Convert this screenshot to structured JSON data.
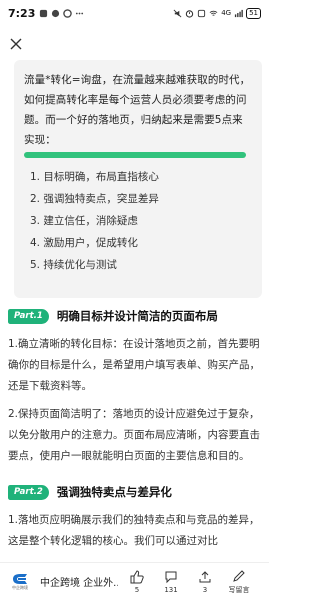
{
  "status_bar": {
    "time": "7:23",
    "network": "4G",
    "battery": "51"
  },
  "icons": {
    "close": "close-icon",
    "like": "thumbs-up-icon",
    "comment": "comment-icon",
    "share": "share-icon",
    "write": "pencil-icon"
  },
  "colors": {
    "accent": "#1fb27a",
    "highlight": "#31c27c"
  },
  "intro": {
    "text": "流量*转化=询盘，在流量越来越难获取的时代，如何提高转化率是每个运营人员必须要考虑的问题。而一个好的落地页，归纳起来是需要5点来实现：",
    "steps": [
      "1. 目标明确，布局直指核心",
      "2. 强调独特卖点，突显差异",
      "3. 建立信任，消除疑虑",
      "4. 激励用户，促成转化",
      "5. 持续优化与测试"
    ]
  },
  "section1": {
    "tag": "Part.1",
    "title": "明确目标并设计简洁的页面布局",
    "p1": "1.确立清晰的转化目标：在设计落地页之前，首先要明确你的目标是什么，是希望用户填写表单、购买产品，还是下载资料等。",
    "p2": "2.保持页面简洁明了：落地页的设计应避免过于复杂，以免分散用户的注意力。页面布局应清晰，内容要直击要点，使用户一眼就能明白页面的主要信息和目的。"
  },
  "section2": {
    "tag": "Part.2",
    "title": "强调独特卖点与差异化",
    "p1": "1.落地页应明确展示我们的独特卖点和与竞品的差异，这是整个转化逻辑的核心。我们可以通过对比"
  },
  "bottom": {
    "logo_text": "中企跨境",
    "brand": "中企跨境 企业外...",
    "like_count": "5",
    "comment_count": "131",
    "share_count": "3",
    "write_label": "写留言"
  }
}
